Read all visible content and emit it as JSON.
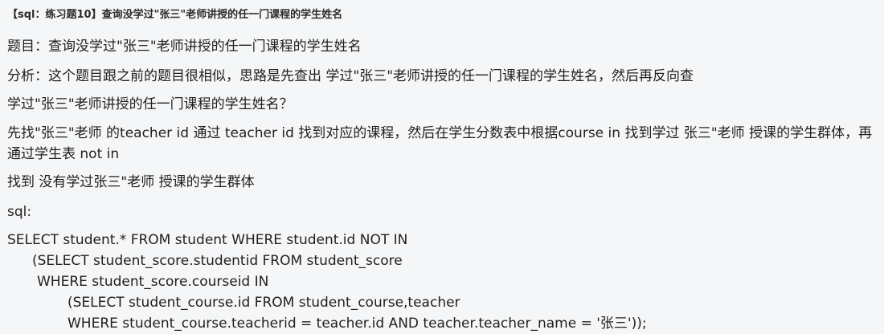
{
  "post": {
    "title": "【sql：练习题10】查询没学过\"张三\"老师讲授的任一门课程的学生姓名",
    "paragraphs": [
      "题目：查询没学过\"张三\"老师讲授的任一门课程的学生姓名",
      "分析：这个题目跟之前的题目很相似，思路是先查出  学过\"张三\"老师讲授的任一门课程的学生姓名，然后再反向查",
      "学过\"张三\"老师讲授的任一门课程的学生姓名？",
      "先找\"张三\"老师 的teacher id  通过 teacher id 找到对应的课程，然后在学生分数表中根据course  in  找到学过 张三\"老师 授课的学生群体，再通过学生表 not in",
      "找到 没有学过张三\"老师 授课的学生群体",
      "sql:"
    ],
    "code": [
      "SELECT student.* FROM student WHERE student.id NOT IN",
      "(SELECT student_score.studentid FROM student_score",
      "WHERE student_score.courseid IN",
      "(SELECT student_course.id FROM student_course,teacher",
      "WHERE student_course.teacherid = teacher.id AND teacher.teacher_name = '张三'));"
    ]
  }
}
